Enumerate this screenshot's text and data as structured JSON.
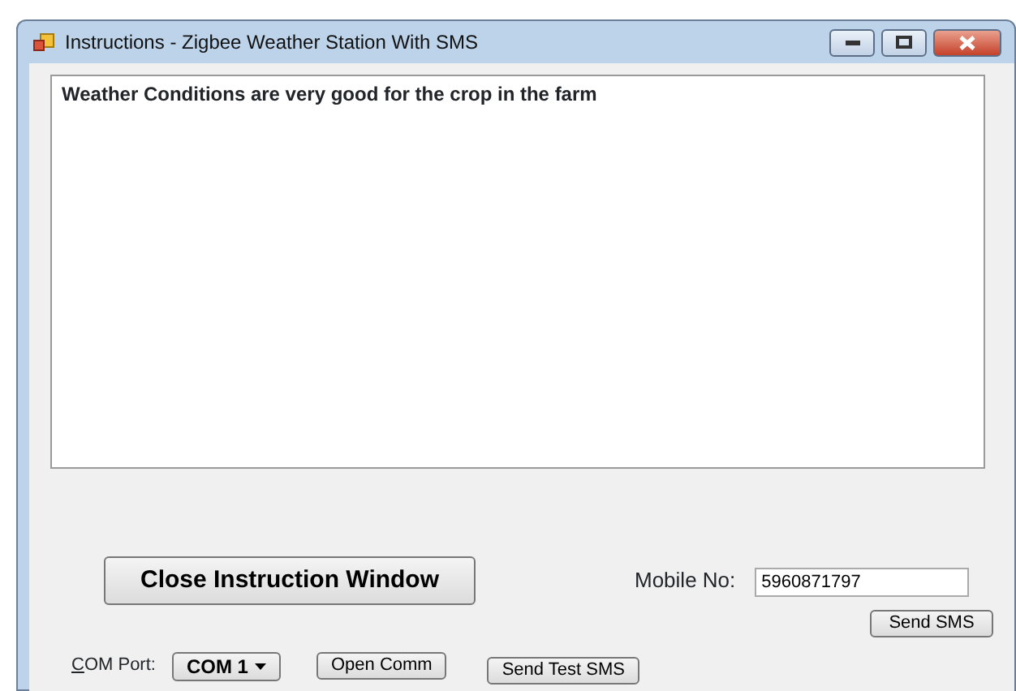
{
  "window": {
    "title": "Instructions - Zigbee Weather Station With SMS"
  },
  "message": "Weather Conditions are very good for the crop in the farm",
  "close_button": "Close Instruction Window",
  "mobile": {
    "label": "Mobile No:",
    "value": "5960871797"
  },
  "send_sms_button": "Send SMS",
  "com_port": {
    "label": "COM Port:",
    "value": "COM 1"
  },
  "open_comm_button": "Open Comm",
  "send_test_button": "Send Test SMS"
}
